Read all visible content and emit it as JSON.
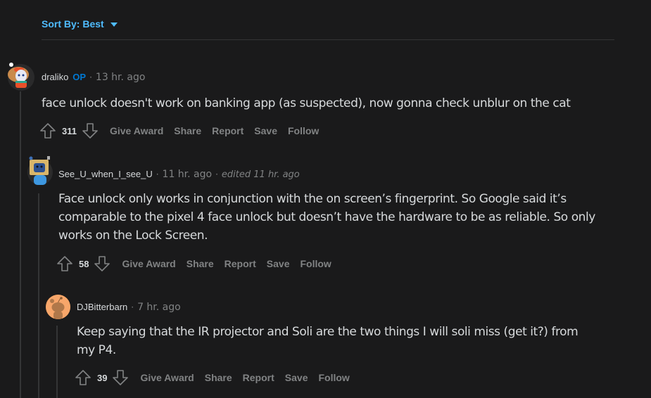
{
  "sort": {
    "label": "Sort By: Best",
    "icon": "caret-down-icon"
  },
  "comments": [
    {
      "author": "draliko",
      "op_badge": "OP",
      "separator": "·",
      "time": "13 hr. ago",
      "body": "face unlock doesn't work on banking app (as suspected), now gonna check unblur on the cat",
      "score": "311",
      "actions": [
        "Give Award",
        "Share",
        "Report",
        "Save",
        "Follow"
      ]
    },
    {
      "author": "See_U_when_I_see_U",
      "separator": "·",
      "time": "11 hr. ago",
      "edited": "edited 11 hr. ago",
      "body": "Face unlock only works in conjunction with the on screen’s fingerprint. So Google said it’s comparable to the pixel 4 face unlock but doesn’t have the hardware to be as reliable. So only works on the Lock Screen.",
      "score": "58",
      "actions": [
        "Give Award",
        "Share",
        "Report",
        "Save",
        "Follow"
      ]
    },
    {
      "author": "DJBitterbarn",
      "separator": "·",
      "time": "7 hr. ago",
      "body": "Keep saying that the IR projector and Soli are the two things I will soli miss (get it?) from my P4.",
      "score": "39",
      "actions": [
        "Give Award",
        "Share",
        "Report",
        "Save",
        "Follow"
      ]
    }
  ],
  "colors": {
    "background": "#1a1a1b",
    "accent": "#4fbcff",
    "op": "#0079d3",
    "muted": "#818384",
    "text": "#d7dadc"
  }
}
